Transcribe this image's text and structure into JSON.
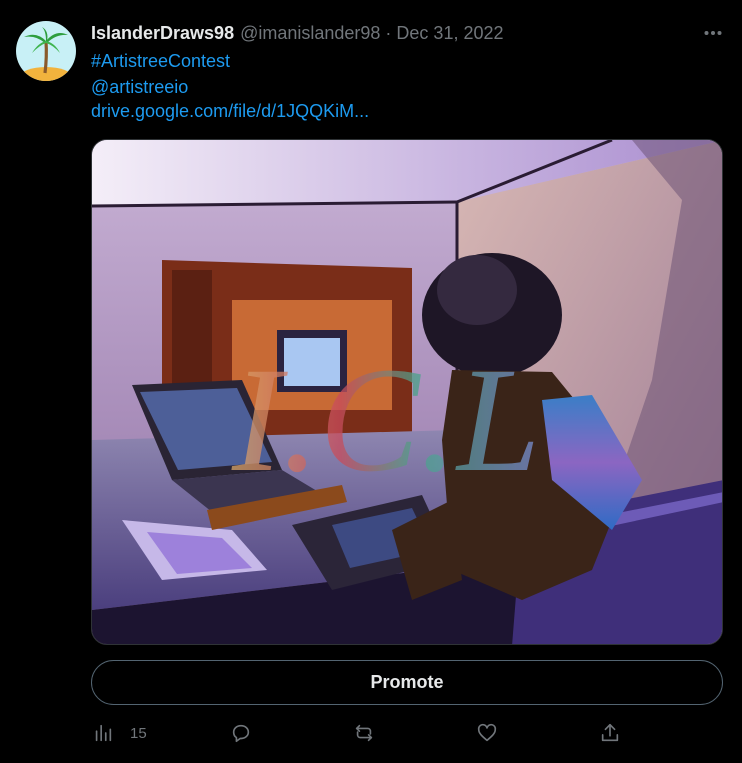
{
  "tweet": {
    "display_name": "IslanderDraws98",
    "handle": "@imanislander98",
    "separator": "·",
    "date": "Dec 31, 2022",
    "hashtag": "#ArtistreeContest",
    "mention": "@artistreeio",
    "link": "drive.google.com/file/d/1JQQKiM...",
    "media_watermark": "I.C.L",
    "avatar_icon": "palm-tree-island-icon"
  },
  "promote_label": "Promote",
  "actions": {
    "analytics_count": "15",
    "icons": [
      "analytics-icon",
      "reply-icon",
      "retweet-icon",
      "like-icon",
      "share-icon"
    ]
  },
  "colors": {
    "background": "#000000",
    "text": "#e7e9ea",
    "muted": "#71767b",
    "link": "#1d9bf0",
    "avatar_bg": "#c8f0f6"
  }
}
